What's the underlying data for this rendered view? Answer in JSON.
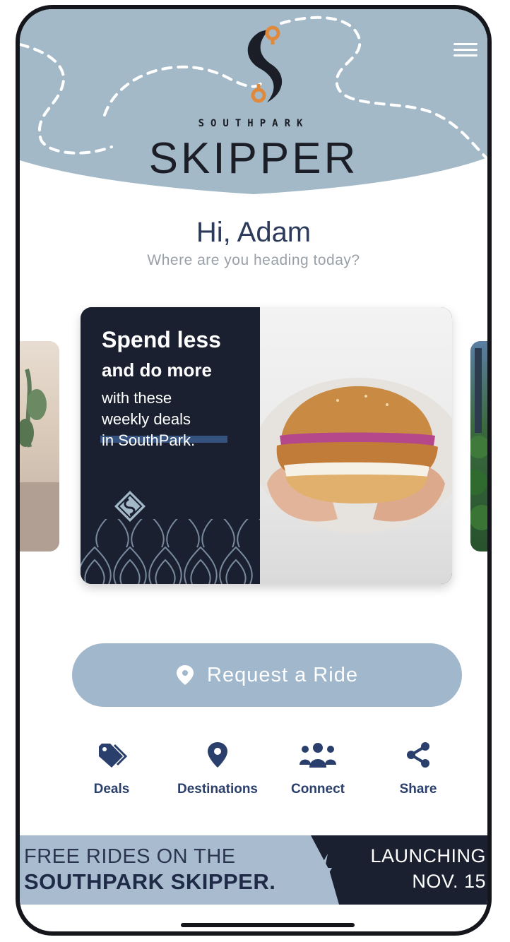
{
  "header": {
    "brand_small": "SOUTHPARK",
    "brand_large": "SKIPPER",
    "accent_color": "#e0893a",
    "background_color": "#a3b9c8",
    "menu_icon": "hamburger-menu-icon"
  },
  "greeting": {
    "title": "Hi, Adam",
    "subtitle": "Where are you heading today?"
  },
  "carousel": {
    "active_card": {
      "headline_1": "Spend less",
      "headline_2": "and do more",
      "line_1": "with these",
      "line_2": "weekly deals",
      "line_3": "in SouthPark."
    }
  },
  "ride_button": {
    "label": "Request a Ride",
    "icon": "location-pin-icon"
  },
  "actions": [
    {
      "label": "Deals",
      "icon": "tag-icon"
    },
    {
      "label": "Destinations",
      "icon": "location-pin-icon"
    },
    {
      "label": "Connect",
      "icon": "people-group-icon"
    },
    {
      "label": "Share",
      "icon": "share-icon"
    }
  ],
  "banner": {
    "line_1": "FREE RIDES ON THE",
    "line_2": "SOUTHPARK SKIPPER.",
    "right_1": "LAUNCHING",
    "right_2": "NOV. 15"
  }
}
